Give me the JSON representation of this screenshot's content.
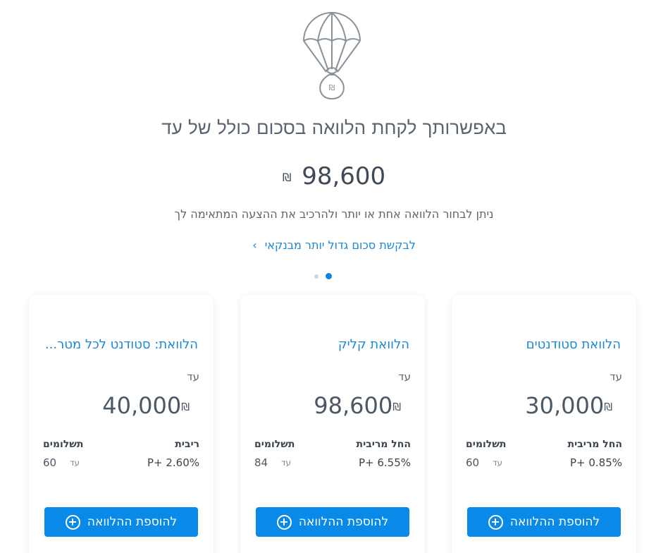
{
  "hero": {
    "icon": "parachute-money-bag-icon",
    "headline": "באפשרותך לקחת הלוואה בסכום כולל של עד",
    "total_amount": "98,600",
    "currency": "₪",
    "subtext": "ניתן לבחור הלוואה אחת או יותר ולהרכיב את ההצעה המתאימה לך",
    "bank_link": "לבקשת סכום גדול יותר מבנקאי",
    "bank_link_icon": "chevron-left-icon"
  },
  "carousel": {
    "dots": 2,
    "active": 1
  },
  "currency": "₪",
  "add_label": "להוספת ההלוואה",
  "up_to": "עד",
  "cards": [
    {
      "title": "הלוואת סטודנטים",
      "up_to": "עד",
      "amount": "30,000",
      "rate_label": "החל מריבית",
      "rate_value": "P+ 0.85%",
      "payments_label": "תשלומים",
      "payments_up_to": "עד",
      "payments_value": "60"
    },
    {
      "title": "הלוואת קליק",
      "up_to": "עד",
      "amount": "98,600",
      "rate_label": "החל מריבית",
      "rate_value": "P+ 6.55%",
      "payments_label": "תשלומים",
      "payments_up_to": "עד",
      "payments_value": "84"
    },
    {
      "title": "הלוואת: סטודנט לכל מטר...",
      "up_to": "עד",
      "amount": "40,000",
      "rate_label": "ריבית",
      "rate_value": "P+ 2.60%",
      "payments_label": "תשלומים",
      "payments_up_to": "עד",
      "payments_value": "60"
    }
  ],
  "colors": {
    "accent": "#0a8ae8",
    "link": "#1a88d8",
    "text": "#4b5866",
    "dot_inactive": "#cfd5db"
  }
}
